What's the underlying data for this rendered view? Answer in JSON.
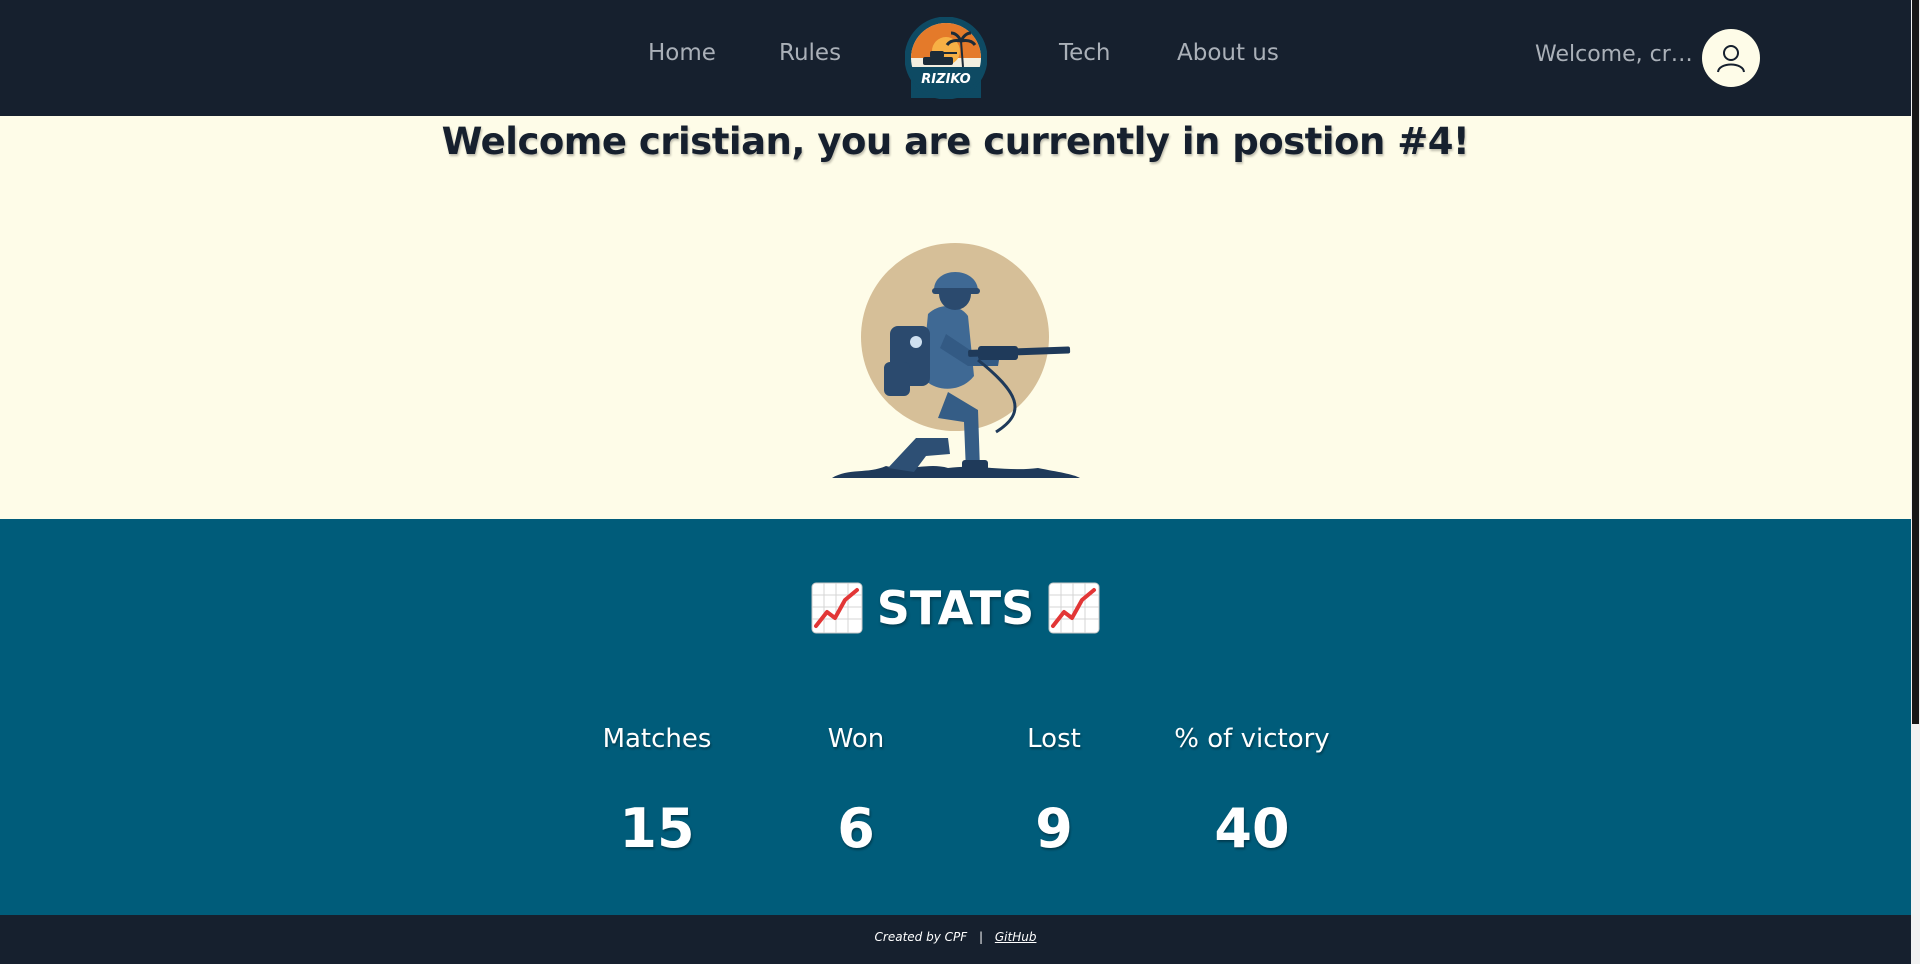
{
  "nav": {
    "links": [
      "Home",
      "Rules",
      "Tech",
      "About us"
    ],
    "logo_text": "RIZIKO",
    "welcome_user": "Welcome, cristi..."
  },
  "hero": {
    "title": "Welcome cristian, you are currently in postion #4!"
  },
  "stats": {
    "title": "STATS",
    "icon": "chart-increasing-icon",
    "columns": [
      {
        "label": "Matches",
        "value": "15"
      },
      {
        "label": "Won",
        "value": "6"
      },
      {
        "label": "Lost",
        "value": "9"
      },
      {
        "label": "% of victory",
        "value": "40"
      }
    ]
  },
  "footer": {
    "created_by": "Created by CPF",
    "separator": "|",
    "github": "GitHub"
  },
  "colors": {
    "navbar": "#16202e",
    "hero_bg": "#fefce8",
    "stats_bg": "#005c7a",
    "accent": "#c9b48f"
  }
}
